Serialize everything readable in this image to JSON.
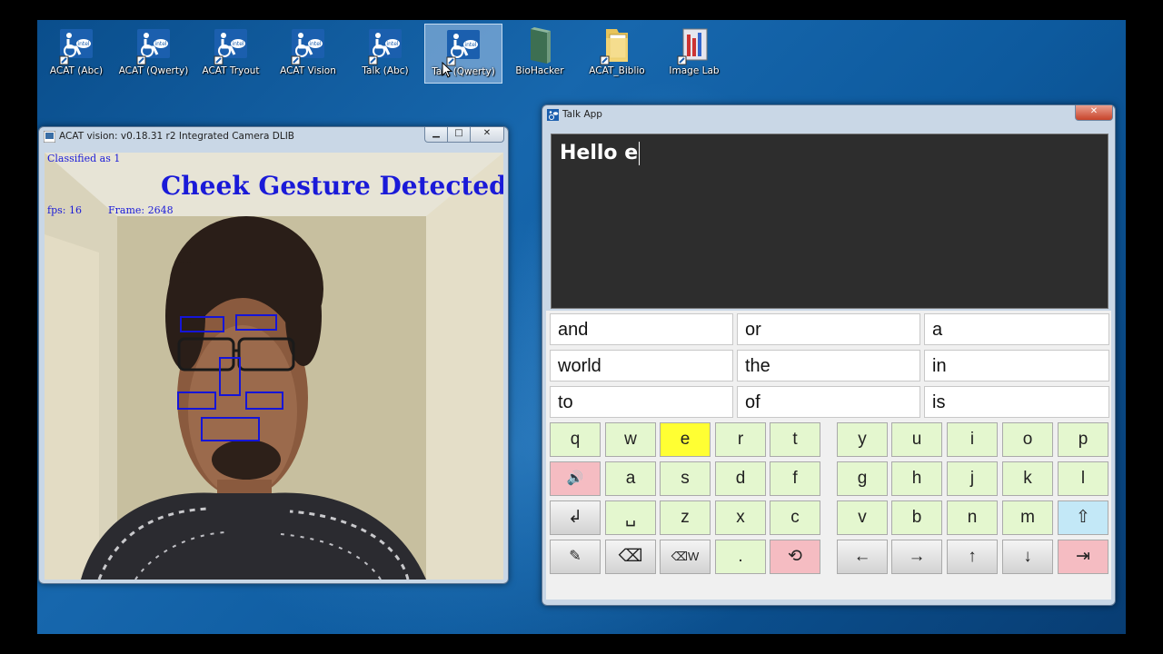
{
  "desktop_icons": [
    {
      "label": "ACAT (Abc)",
      "icon": "acat-wheelchair-icon"
    },
    {
      "label": "ACAT (Qwerty)",
      "icon": "acat-wheelchair-icon"
    },
    {
      "label": "ACAT Tryout",
      "icon": "acat-wheelchair-icon"
    },
    {
      "label": "ACAT Vision",
      "icon": "acat-wheelchair-icon"
    },
    {
      "label": "Talk (Abc)",
      "icon": "acat-wheelchair-icon"
    },
    {
      "label": "Talk (Qwerty)",
      "icon": "acat-wheelchair-icon"
    },
    {
      "label": "BioHacker",
      "icon": "book-icon"
    },
    {
      "label": "ACAT_Biblio",
      "icon": "folder-icon"
    },
    {
      "label": "Image Lab",
      "icon": "image-lab-icon"
    }
  ],
  "vision_window": {
    "title": "ACAT vision: v0.18.31 r2 Integrated Camera DLIB",
    "buttons": {
      "minimize": "▁",
      "maximize": "□",
      "close": "✕"
    },
    "overlay": {
      "classified": "Classified as 1",
      "gesture": "Cheek Gesture Detected",
      "fps": "fps: 16",
      "frame": "Frame: 2648"
    }
  },
  "talk_window": {
    "title": "Talk App",
    "close": "✕",
    "text": "Hello e",
    "word_predictions": [
      [
        "and",
        "or",
        "a"
      ],
      [
        "world",
        "the",
        "in"
      ],
      [
        "to",
        "of",
        "is"
      ]
    ],
    "keyboard": {
      "row1": [
        "q",
        "w",
        "e",
        "r",
        "t",
        "y",
        "u",
        "i",
        "o",
        "p"
      ],
      "row2": [
        "🔊",
        "a",
        "s",
        "d",
        "f",
        "g",
        "h",
        "j",
        "k",
        "l"
      ],
      "row3": [
        "↲",
        "␣",
        "z",
        "x",
        "c",
        "v",
        "b",
        "n",
        "m",
        "⇧"
      ],
      "row4": [
        "✎",
        "⌫",
        "⌫W",
        ".",
        "⟲",
        "←",
        "→",
        "↑",
        "↓",
        "⇥"
      ]
    },
    "highlighted_key": "e"
  },
  "colors": {
    "key_green": "#e4f7cf",
    "key_highlight": "#ffff33",
    "key_red": "#f5bcc2",
    "key_blue": "#c3e8f7",
    "overlay_text": "#1a1ad8",
    "text_area": "#2d2d2d"
  }
}
